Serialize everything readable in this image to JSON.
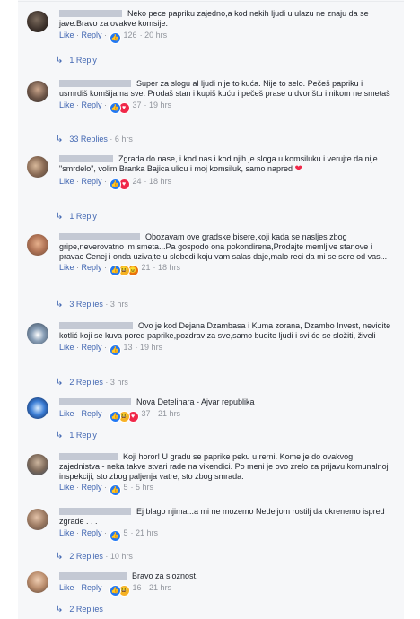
{
  "comments": [
    {
      "text": "Neko pece papriku zajedno,a kod nekih ljudi u ulazu ne znaju da se jave.Bravo za ovakve komsije.",
      "like": "Like",
      "reply": "Reply",
      "reactions": [
        "like"
      ],
      "count": "126",
      "time": "20 hrs",
      "replies": "1 Reply",
      "replies_time": ""
    },
    {
      "text": "Super za slogu al ljudi nije to kuća. Nije to selo. Pečeš papriku i usmrdiš komšijama sve. Prodaš stan i kupiš kuću i pečeš prase u dvorištu i nikom ne smetaš",
      "like": "Like",
      "reply": "Reply",
      "reactions": [
        "like",
        "love"
      ],
      "count": "37",
      "time": "19 hrs",
      "replies": "33 Replies",
      "replies_time": "6 hrs"
    },
    {
      "text": "Zgrada do nase, i kod nas i kod njih je sloga u komsiluku i verujte da nije \"smrdelo\", volim Branka Bajica ulicu i moj komsiluk, samo napred",
      "like": "Like",
      "reply": "Reply",
      "reactions": [
        "like",
        "love"
      ],
      "count": "24",
      "time": "18 hrs",
      "replies": "1 Reply",
      "replies_time": ""
    },
    {
      "text": "Obozavam ove gradske bisere,koji kada se nasljes zbog gripe,neverovatno im smeta...Pa gospodo ona pokondirena,Prodajte memljive stanove i pravac Cenej i onda uzivajte u slobodi koju vam salas daje,malo reci da mi se sere od vas...",
      "like": "Like",
      "reply": "Reply",
      "reactions": [
        "like",
        "haha",
        "angry"
      ],
      "count": "21",
      "time": "18 hrs",
      "replies": "3 Replies",
      "replies_time": "3 hrs"
    },
    {
      "text": "Ovo je kod Dejana Dzambasa i Kuma zorana, Dzambo Invest, nevidite kotlić koji se kuva pored paprike,pozdrav za sve,samo budite ljudi i svi će se složiti, živeli",
      "like": "Like",
      "reply": "Reply",
      "reactions": [
        "like"
      ],
      "count": "13",
      "time": "19 hrs",
      "replies": "2 Replies",
      "replies_time": "3 hrs"
    },
    {
      "text": "Nova Detelinara - Ajvar republika",
      "like": "Like",
      "reply": "Reply",
      "reactions": [
        "like",
        "haha",
        "love"
      ],
      "count": "37",
      "time": "21 hrs",
      "replies": "1 Reply",
      "replies_time": ""
    },
    {
      "text": "Koji horor! U gradu se paprike peku u rerni. Kome je do ovakvog zajednistva - neka takve stvari rade na vikendici. Po meni je ovo zrelo za prijavu komunalnoj inspekciji, sto zbog paljenja vatre, sto zbog smrada.",
      "like": "Like",
      "reply": "Reply",
      "reactions": [
        "like"
      ],
      "count": "5",
      "time": "5 hrs",
      "replies": "",
      "replies_time": ""
    },
    {
      "text": "Ej blago njima...a mi ne mozemo Nedeljom rostilj da okrenemo ispred zgrade . . .",
      "like": "Like",
      "reply": "Reply",
      "reactions": [
        "like"
      ],
      "count": "5",
      "time": "21 hrs",
      "replies": "2 Replies",
      "replies_time": "10 hrs"
    },
    {
      "text": "Bravo za sloznost.",
      "like": "Like",
      "reply": "Reply",
      "reactions": [
        "like",
        "haha"
      ],
      "count": "16",
      "time": "21 hrs",
      "replies": "2 Replies",
      "replies_time": ""
    }
  ],
  "colors": {
    "link": "#4267b2",
    "meta": "#90949c",
    "like": "#2078f4",
    "love": "#f02849",
    "haha": "#f7b125",
    "angry": "#e9710f"
  }
}
